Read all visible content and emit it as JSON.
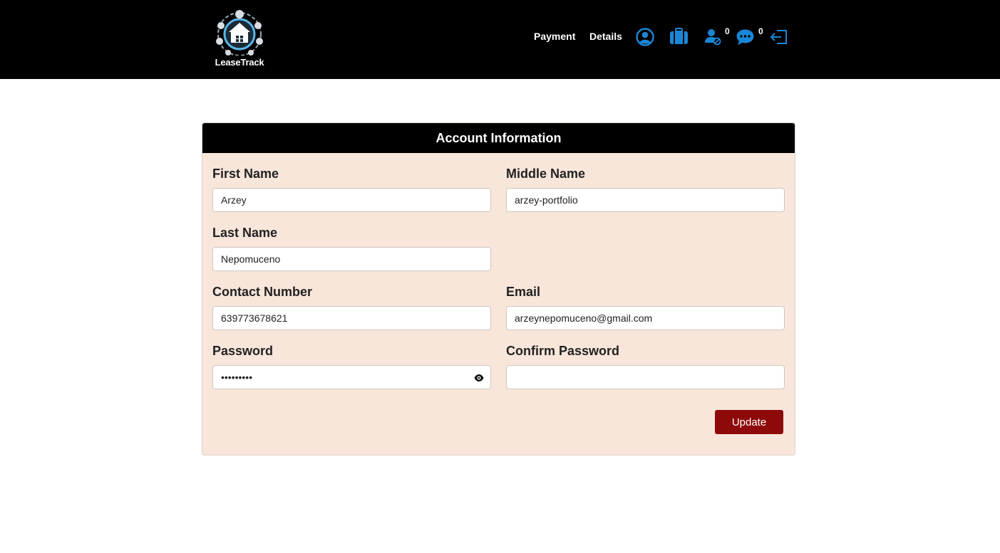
{
  "brand": {
    "name": "LeaseTrack",
    "icon": "house-network-logo"
  },
  "nav": {
    "links": [
      {
        "label": "Payment"
      },
      {
        "label": "Details"
      }
    ],
    "icons": {
      "profile": "user-circle-icon",
      "lease": "briefcase-icon",
      "blocked_users": "user-block-icon",
      "messages": "chat-bubble-icon",
      "logout": "logout-icon"
    },
    "blocked_users_count": "0",
    "messages_count": "0"
  },
  "form": {
    "title": "Account Information",
    "first_name": {
      "label": "First Name",
      "value": "Arzey"
    },
    "middle_name": {
      "label": "Middle Name",
      "value": "arzey-portfolio"
    },
    "last_name": {
      "label": "Last Name",
      "value": "Nepomuceno"
    },
    "contact_number": {
      "label": "Contact Number",
      "value": "639773678621"
    },
    "email": {
      "label": "Email",
      "value": "arzeynepomuceno@gmail.com"
    },
    "password": {
      "label": "Password",
      "value": "arzeypass"
    },
    "confirm_password": {
      "label": "Confirm Password",
      "value": ""
    },
    "submit_label": "Update"
  },
  "colors": {
    "navbar": "#000000",
    "accent_blue": "#1a87d6",
    "card_bg": "#f8e6da",
    "button": "#8e0a0a"
  }
}
